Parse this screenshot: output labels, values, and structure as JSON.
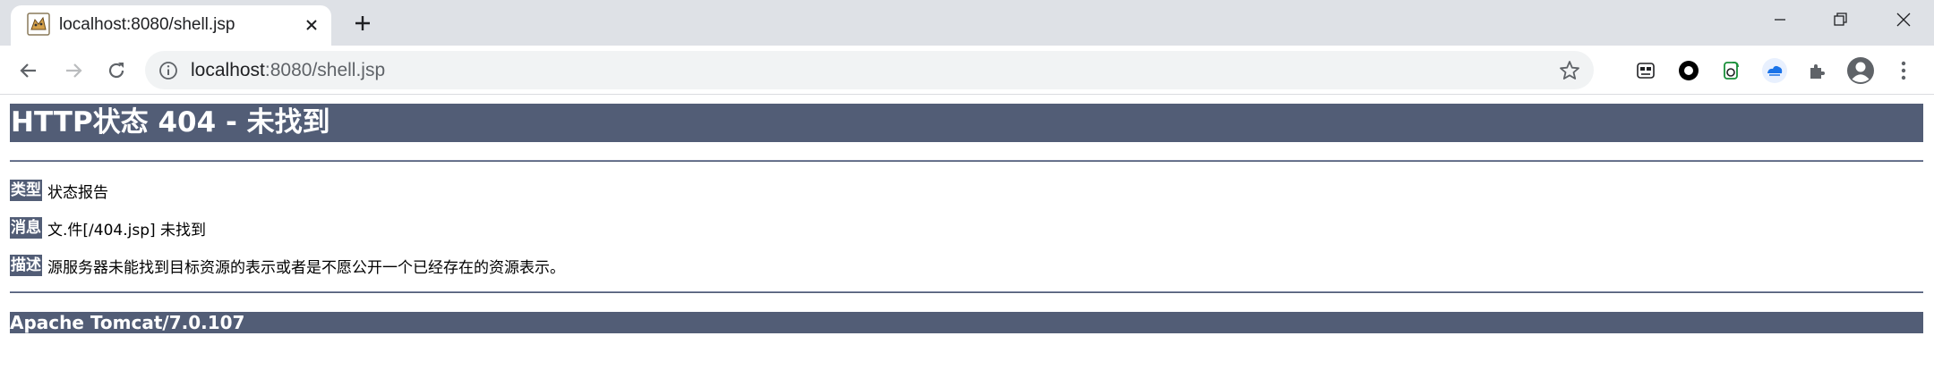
{
  "browser": {
    "tab": {
      "title": "localhost:8080/shell.jsp"
    },
    "omnibox": {
      "host": "localhost",
      "rest": ":8080/shell.jsp"
    }
  },
  "page": {
    "heading": "HTTP状态 404 - 未找到",
    "rows": [
      {
        "label": "类型",
        "value": "状态报告"
      },
      {
        "label": "消息",
        "value": "文.件[/404.jsp] 未找到"
      },
      {
        "label": "描述",
        "value": "源服务器未能找到目标资源的表示或者是不愿公开一个已经存在的资源表示。"
      }
    ],
    "footer": "Apache Tomcat/7.0.107"
  },
  "colors": {
    "tomcat_bar": "#525d76",
    "tab_strip": "#dee1e6",
    "omnibox_bg": "#f1f3f4"
  }
}
